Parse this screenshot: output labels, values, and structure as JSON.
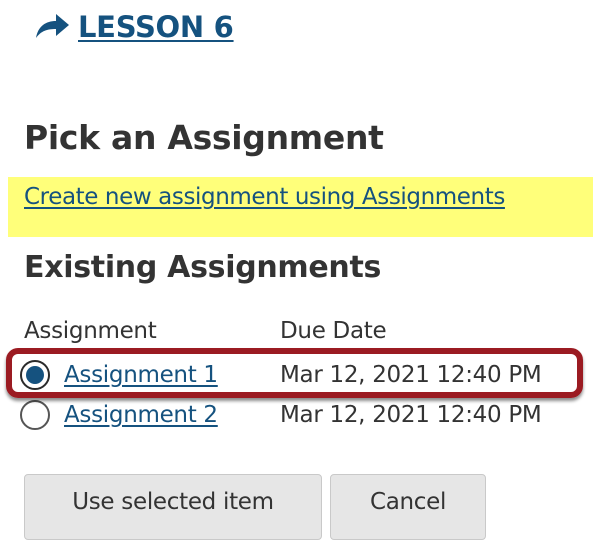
{
  "lesson": {
    "label": "LESSON 6",
    "icon": "share-arrow-icon"
  },
  "page": {
    "heading": "Pick an Assignment",
    "create_link": "Create new assignment using Assignments",
    "existing_heading": "Existing Assignments"
  },
  "table": {
    "headers": [
      "Assignment",
      "Due Date"
    ],
    "rows": [
      {
        "name": "Assignment 1",
        "due": "Mar 12, 2021 12:40 PM",
        "selected": true
      },
      {
        "name": "Assignment 2",
        "due": "Mar 12, 2021 12:40 PM",
        "selected": false
      }
    ]
  },
  "buttons": {
    "use_selected": "Use selected item",
    "cancel": "Cancel"
  },
  "colors": {
    "link": "#15527f",
    "highlight": "#ffff7a",
    "callout": "#9b1b22",
    "button_bg": "#e6e6e6"
  }
}
